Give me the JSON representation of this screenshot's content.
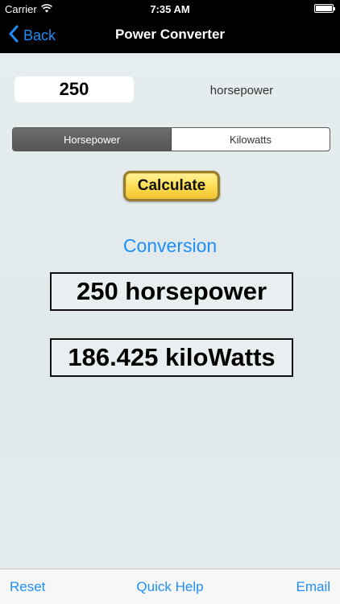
{
  "status": {
    "carrier": "Carrier",
    "time": "7:35 AM"
  },
  "nav": {
    "back_label": "Back",
    "title": "Power Converter"
  },
  "converter": {
    "input_value": "250",
    "unit_label": "horsepower",
    "segments": [
      "Horsepower",
      "Kilowatts"
    ],
    "selected_segment": "Horsepower",
    "calculate_label": "Calculate",
    "section_title": "Conversion",
    "result_from": "250 horsepower",
    "result_to": "186.425 kiloWatts"
  },
  "toolbar": {
    "reset_label": "Reset",
    "help_label": "Quick Help",
    "email_label": "Email"
  },
  "colors": {
    "accent": "#1e8ef8",
    "button_gold": "#ffe15a",
    "bar_black": "#000000"
  }
}
